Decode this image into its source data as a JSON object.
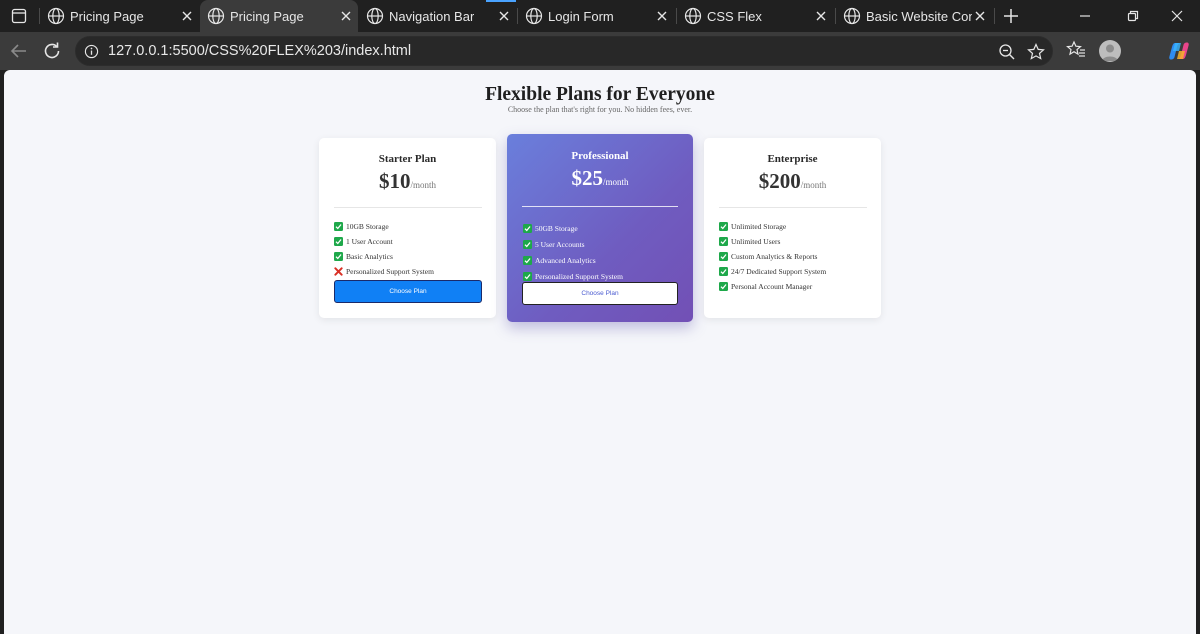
{
  "browser": {
    "tabs": [
      {
        "title": "Pricing Page",
        "active": false
      },
      {
        "title": "Pricing Page",
        "active": true
      },
      {
        "title": "Navigation Bar",
        "active": false
      },
      {
        "title": "Login Form",
        "active": false
      },
      {
        "title": "CSS Flex",
        "active": false
      },
      {
        "title": "Basic Website Comp",
        "active": false
      }
    ],
    "url": "127.0.0.1:5500/CSS%20FLEX%203/index.html"
  },
  "page": {
    "title": "Flexible Plans for Everyone",
    "subtitle": "Choose the plan that's right for you. No hidden fees, ever.",
    "plans": [
      {
        "name": "Starter Plan",
        "price": "$10",
        "period": "/month",
        "features": [
          {
            "text": "10GB Storage",
            "included": true
          },
          {
            "text": "1 User Account",
            "included": true
          },
          {
            "text": "Basic Analytics",
            "included": true
          },
          {
            "text": "Personalized Support System",
            "included": false
          }
        ],
        "button": "Choose Plan"
      },
      {
        "name": "Professional",
        "price": "$25",
        "period": "/month",
        "features": [
          {
            "text": "50GB Storage",
            "included": true
          },
          {
            "text": "5 User Accounts",
            "included": true
          },
          {
            "text": "Advanced Analytics",
            "included": true
          },
          {
            "text": "Personalized Support System",
            "included": true
          }
        ],
        "button": "Choose Plan"
      },
      {
        "name": "Enterprise",
        "price": "$200",
        "period": "/month",
        "features": [
          {
            "text": "Unlimited Storage",
            "included": true
          },
          {
            "text": "Unlimited Users",
            "included": true
          },
          {
            "text": "Custom Analytics & Reports",
            "included": true
          },
          {
            "text": "24/7 Dedicated Support System",
            "included": true
          },
          {
            "text": "Personal Account Manager",
            "included": true
          }
        ]
      }
    ]
  },
  "colors": {
    "primary_button": "#1080f5",
    "featured_gradient_start": "#6a7fdc",
    "featured_gradient_end": "#7250b5",
    "check_green": "#1ea84a",
    "cross_red": "#d93025",
    "page_bg": "#f5f6fa"
  },
  "icons": {
    "included": "check-box-icon",
    "excluded": "cross-icon"
  }
}
